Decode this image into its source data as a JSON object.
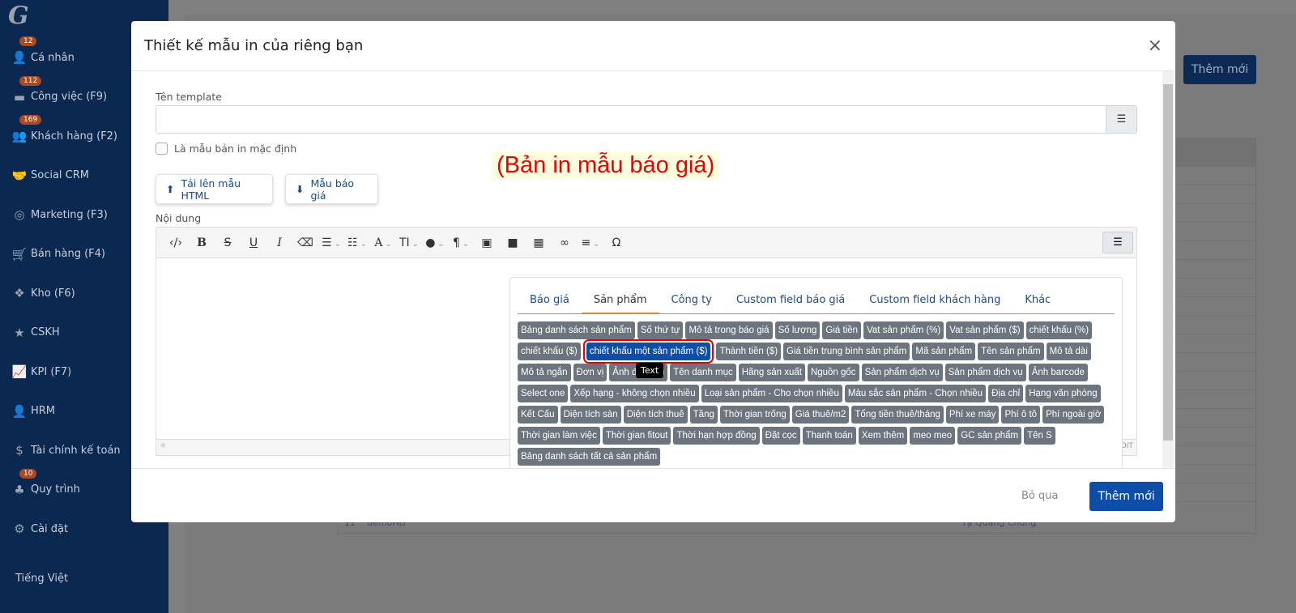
{
  "sidebar": {
    "logo": "G",
    "items": [
      {
        "label": "Cá nhân",
        "icon": "user-icon",
        "badge": "12"
      },
      {
        "label": "Công việc (F9)",
        "icon": "briefcase-icon",
        "badge": "112"
      },
      {
        "label": "Khách hàng (F2)",
        "icon": "users-icon",
        "badge": "169"
      },
      {
        "label": "Social CRM",
        "icon": "handshake-icon",
        "badge": ""
      },
      {
        "label": "Marketing (F3)",
        "icon": "bullseye-icon",
        "badge": ""
      },
      {
        "label": "Bán hàng (F4)",
        "icon": "cart-icon",
        "badge": ""
      },
      {
        "label": "Kho (F6)",
        "icon": "cubes-icon",
        "badge": ""
      },
      {
        "label": "CSKH",
        "icon": "star-icon",
        "badge": ""
      },
      {
        "label": "KPI (F7)",
        "icon": "chart-line-icon",
        "badge": ""
      },
      {
        "label": "HRM",
        "icon": "user-tie-icon",
        "badge": ""
      },
      {
        "label": "Tài chính kế toán",
        "icon": "dollar-icon",
        "badge": ""
      },
      {
        "label": "Quy trình",
        "icon": "sitemap-icon",
        "badge": "10"
      },
      {
        "label": "Cài đặt",
        "icon": "gear-icon",
        "badge": ""
      }
    ],
    "language": "Tiếng Việt"
  },
  "background": {
    "add_button": "Thêm mới",
    "last_row": {
      "no": "11",
      "name": "demoHD",
      "owner": "Tạ Quang Chung"
    }
  },
  "modal": {
    "title": "Thiết kế mẫu in của riêng bạn",
    "template_label": "Tên template",
    "template_value": "",
    "default_checkbox": "Là mẫu bản in mặc định",
    "default_checked": false,
    "annotation": "(Bản in mẫu báo giá)",
    "upload_button": "Tải lên mẫu HTML",
    "sample_button": "Mẫu báo giá",
    "content_label": "Nội dung",
    "status_right": "DIT",
    "tabs": [
      "Báo giá",
      "Sản phẩm",
      "Công ty",
      "Custom field báo giá",
      "Custom field khách hàng",
      "Khác"
    ],
    "active_tab": "Sản phẩm",
    "tooltip": "Text",
    "selected_chip": "chiết khấu một sản phẩm ($)",
    "chips": [
      "Bảng danh sách sản phẩm",
      "Số thứ tự",
      "Mô tả trong báo giá",
      "Số lượng",
      "Giá tiền",
      "Vat sản phẩm (%)",
      "Vat sản phẩm ($)",
      "chiết khấu (%)",
      "chiết khấu ($)",
      "chiết khấu một sản phẩm ($)",
      "Thành tiền ($)",
      "Giá tiền trung bình sản phẩm",
      "Mã sản phẩm",
      "Tên sản phẩm",
      "Mô tả dài",
      "Mô tả ngắn",
      "Đơn vị",
      "Ảnh đại diện",
      "Tên danh mục",
      "Hãng sản xuất",
      "Nguồn gốc",
      "Sản phẩm dịch vụ",
      "Sản phẩm dịch vụ",
      "Ảnh barcode",
      "Select one",
      "Xếp hạng - không chọn nhiều",
      "Loại sản phẩm - Cho chọn nhiều",
      "Màu sắc sản phẩm - Chọn nhiều",
      "Địa chỉ",
      "Hạng văn phòng",
      "Kết Cấu",
      "Diện tích sàn",
      "Diện tích thuê",
      "Tầng",
      "Thời gian trống",
      "Giá thuê/m2",
      "Tổng tiền thuê/tháng",
      "Phí xe máy",
      "Phí ô tô",
      "Phí ngoài giờ",
      "Thời gian làm việc",
      "Thời gian fitout",
      "Thời hạn hợp đồng",
      "Đặt cọc",
      "Thanh toán",
      "Xem thêm",
      "meo meo",
      "GC sản phẩm",
      "Tên S",
      "Bảng danh sách tất cả sản phẩm"
    ],
    "cancel": "Bỏ qua",
    "submit": "Thêm mới"
  },
  "colors": {
    "sidebar": "#0a2850",
    "primary": "#0d4ea8",
    "chip": "#6c757d",
    "tab_accent": "#f08030",
    "highlight": "#ff0000"
  }
}
